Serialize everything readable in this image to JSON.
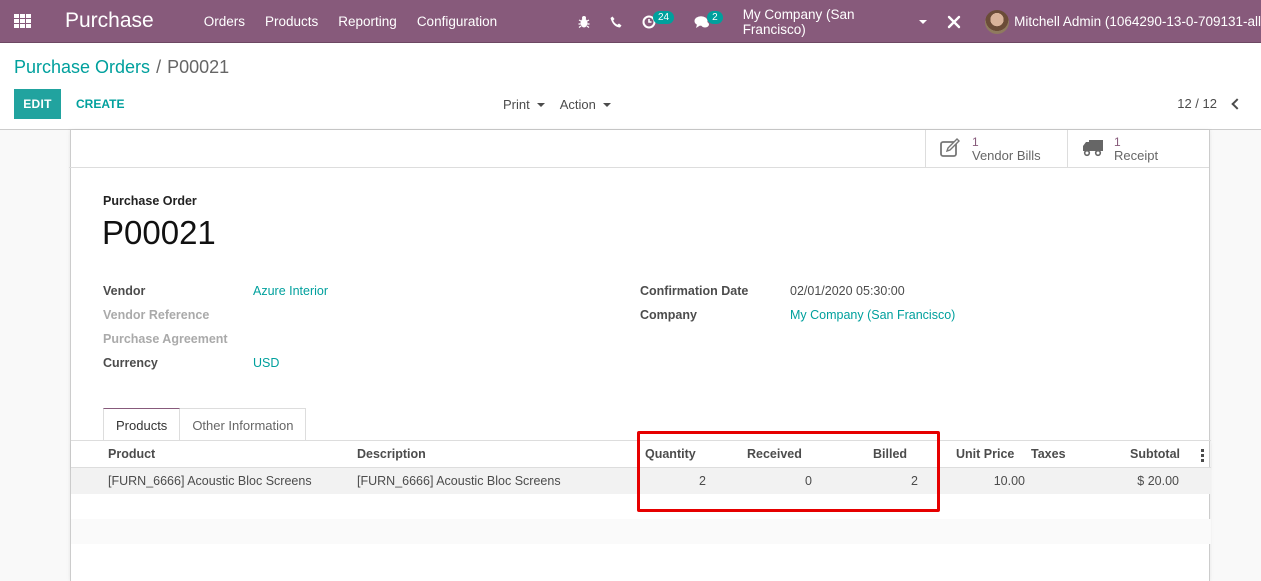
{
  "navbar": {
    "app_title": "Purchase",
    "menu": [
      "Orders",
      "Products",
      "Reporting",
      "Configuration"
    ],
    "activity_count": "24",
    "messages_count": "2",
    "company": "My Company (San Francisco)",
    "user": "Mitchell Admin (1064290-13-0-709131-all"
  },
  "breadcrumb": {
    "parent": "Purchase Orders",
    "separator": "/",
    "current": "P00021"
  },
  "toolbar": {
    "edit_label": "EDIT",
    "create_label": "CREATE",
    "print_label": "Print",
    "action_label": "Action",
    "pager": "12 / 12"
  },
  "smart_buttons": [
    {
      "count": "1",
      "label": "Vendor Bills",
      "icon": "pencil-square-icon"
    },
    {
      "count": "1",
      "label": "Receipt",
      "icon": "truck-icon"
    }
  ],
  "form": {
    "title_label": "Purchase Order",
    "name": "P00021",
    "left_fields": [
      {
        "label": "Vendor",
        "value": "Azure Interior",
        "muted": false
      },
      {
        "label": "Vendor Reference",
        "value": "",
        "muted": true
      },
      {
        "label": "Purchase Agreement",
        "value": "",
        "muted": true
      },
      {
        "label": "Currency",
        "value": "USD",
        "muted": false
      }
    ],
    "right_fields": [
      {
        "label": "Confirmation Date",
        "value": "02/01/2020 05:30:00"
      },
      {
        "label": "Company",
        "value": "My Company (San Francisco)"
      }
    ]
  },
  "tabs": [
    "Products",
    "Other Information"
  ],
  "order_lines": {
    "columns": [
      "Product",
      "Description",
      "Quantity",
      "Received",
      "Billed",
      "Unit Price",
      "Taxes",
      "Subtotal"
    ],
    "rows": [
      {
        "product": "[FURN_6666] Acoustic Bloc Screens",
        "description": "[FURN_6666] Acoustic Bloc Screens",
        "quantity": "2",
        "received": "0",
        "billed": "2",
        "unit_price": "10.00",
        "taxes": "",
        "subtotal": "$ 20.00"
      }
    ]
  },
  "colors": {
    "brand": "#875a7b",
    "accent": "#00a09d",
    "highlight": "#e60000"
  }
}
